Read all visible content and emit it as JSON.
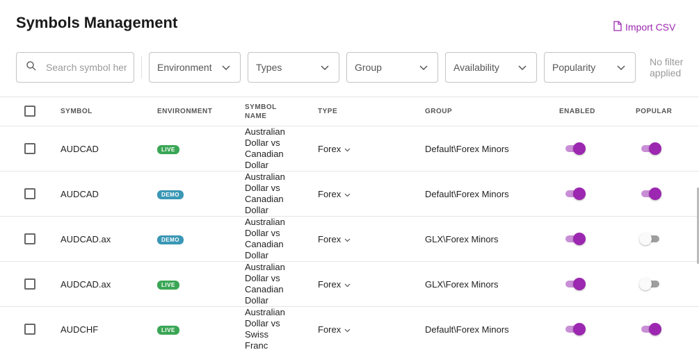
{
  "page": {
    "title": "Symbols Management",
    "import_label": "Import CSV"
  },
  "filters": {
    "search_placeholder": "Search symbol here",
    "environment": "Environment",
    "types": "Types",
    "group": "Group",
    "availability": "Availability",
    "popularity": "Popularity",
    "status_line1": "No filter",
    "status_line2": "applied"
  },
  "table": {
    "headers": {
      "symbol": "SYMBOL",
      "environment": "ENVIRONMENT",
      "symbol_name_line1": "SYMBOL",
      "symbol_name_line2": "NAME",
      "type": "TYPE",
      "group": "GROUP",
      "enabled": "ENABLED",
      "popular": "POPULAR"
    },
    "rows": [
      {
        "symbol": "AUDCAD",
        "environment": "LIVE",
        "name": [
          "Australian",
          "Dollar vs",
          "Canadian",
          "Dollar"
        ],
        "type": "Forex",
        "group": "Default\\Forex Minors",
        "enabled": true,
        "popular": true
      },
      {
        "symbol": "AUDCAD",
        "environment": "DEMO",
        "name": [
          "Australian",
          "Dollar vs",
          "Canadian",
          "Dollar"
        ],
        "type": "Forex",
        "group": "Default\\Forex Minors",
        "enabled": true,
        "popular": true
      },
      {
        "symbol": "AUDCAD.ax",
        "environment": "DEMO",
        "name": [
          "Australian",
          "Dollar vs",
          "Canadian",
          "Dollar"
        ],
        "type": "Forex",
        "group": "GLX\\Forex Minors",
        "enabled": true,
        "popular": false
      },
      {
        "symbol": "AUDCAD.ax",
        "environment": "LIVE",
        "name": [
          "Australian",
          "Dollar vs",
          "Canadian",
          "Dollar"
        ],
        "type": "Forex",
        "group": "GLX\\Forex Minors",
        "enabled": true,
        "popular": false
      },
      {
        "symbol": "AUDCHF",
        "environment": "LIVE",
        "name": [
          "Australian",
          "Dollar vs",
          "Swiss",
          "Franc"
        ],
        "type": "Forex",
        "group": "Default\\Forex Minors",
        "enabled": true,
        "popular": true
      }
    ]
  },
  "colors": {
    "accent": "#9c27b0",
    "live": "#3aa655",
    "demo": "#3a97b5"
  }
}
